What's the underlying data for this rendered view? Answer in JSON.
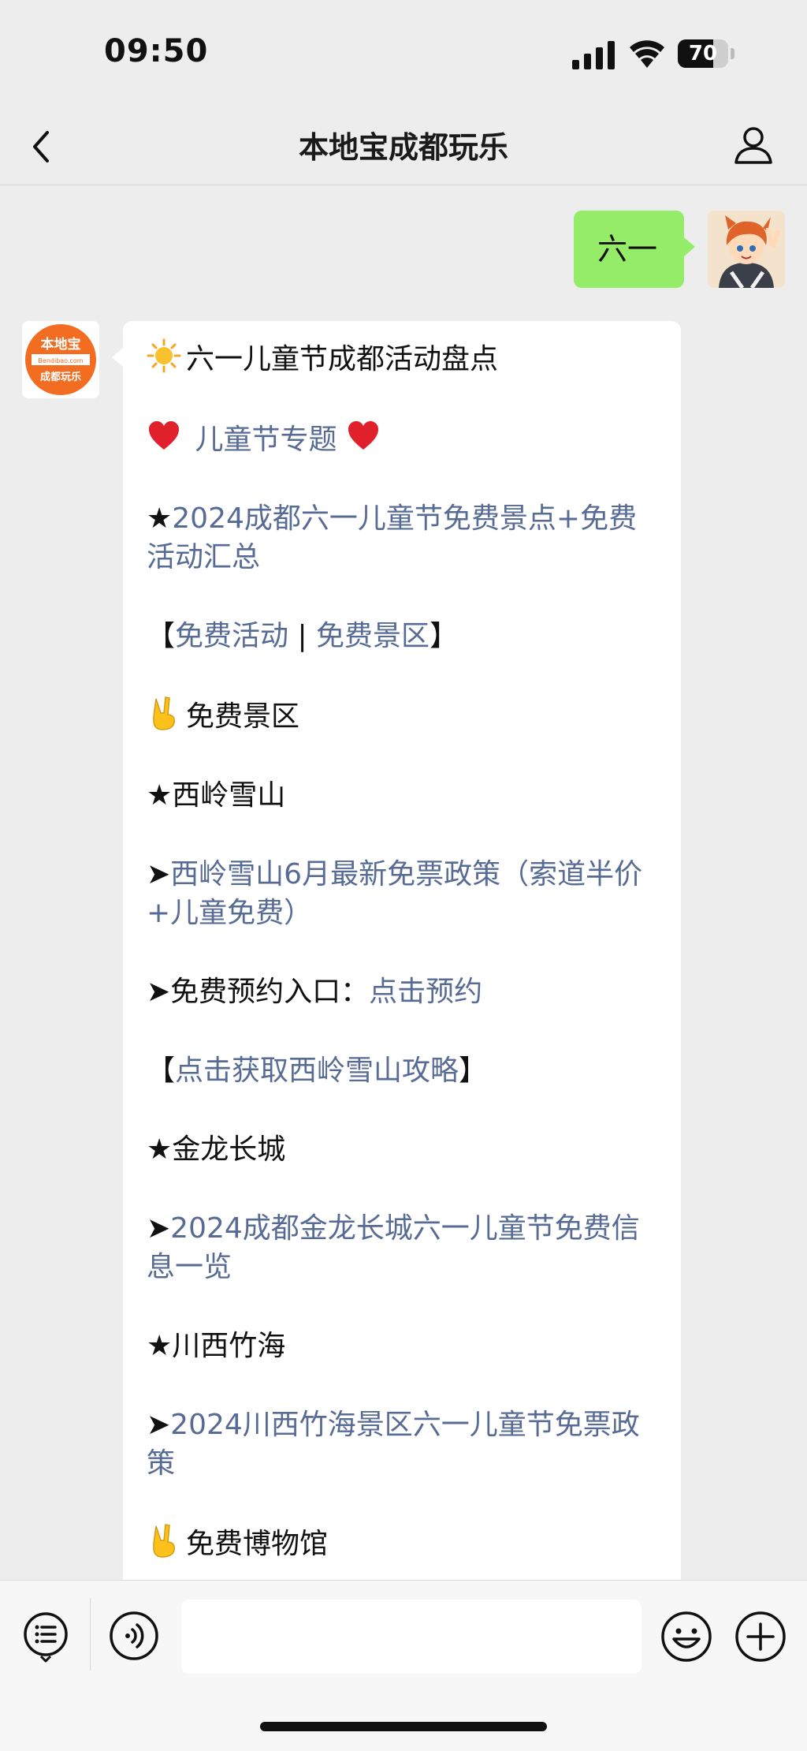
{
  "status_bar": {
    "time": "09:50",
    "battery_level": "70",
    "battery_fraction": 0.7
  },
  "nav": {
    "title": "本地宝成都玩乐"
  },
  "outgoing_message": {
    "text": "六一"
  },
  "bot_avatar": {
    "logo_text": "本地宝",
    "site_text": "Bendibao.com",
    "sub_text": "成都玩乐",
    "brand_color": "#f26d21"
  },
  "message": {
    "lines": [
      {
        "icon": "sun",
        "segments": [
          {
            "text": "六一儿童节成都活动盘点",
            "link": false
          }
        ]
      },
      {
        "icon": "heart",
        "trailing_icon": "heart",
        "segments": [
          {
            "text": " 儿童节专题 ",
            "link": true
          }
        ]
      },
      {
        "icon": null,
        "segments": [
          {
            "text": "★",
            "link": false
          },
          {
            "text": "2024成都六一儿童节免费景点+免费活动汇总",
            "link": true
          }
        ]
      },
      {
        "icon": null,
        "segments": [
          {
            "text": "【",
            "link": false
          },
          {
            "text": "免费活动",
            "link": true
          },
          {
            "text": " | ",
            "link": false
          },
          {
            "text": "免费景区",
            "link": true
          },
          {
            "text": "】",
            "link": false
          }
        ]
      },
      {
        "icon": "victory",
        "segments": [
          {
            "text": "免费景区",
            "link": false
          }
        ]
      },
      {
        "icon": null,
        "segments": [
          {
            "text": "★西岭雪山",
            "link": false
          }
        ]
      },
      {
        "icon": null,
        "segments": [
          {
            "text": "➤",
            "link": false
          },
          {
            "text": "西岭雪山6月最新免票政策（索道半价+儿童免费）",
            "link": true
          }
        ]
      },
      {
        "icon": null,
        "segments": [
          {
            "text": "➤免费预约入口：",
            "link": false
          },
          {
            "text": "点击预约",
            "link": true
          }
        ]
      },
      {
        "icon": null,
        "segments": [
          {
            "text": "【",
            "link": false
          },
          {
            "text": "点击获取西岭雪山攻略",
            "link": true
          },
          {
            "text": "】",
            "link": false
          }
        ]
      },
      {
        "icon": null,
        "segments": [
          {
            "text": "★金龙长城",
            "link": false
          }
        ]
      },
      {
        "icon": null,
        "segments": [
          {
            "text": "➤",
            "link": false
          },
          {
            "text": "2024成都金龙长城六一儿童节免费信息一览",
            "link": true
          }
        ]
      },
      {
        "icon": null,
        "segments": [
          {
            "text": "★川西竹海",
            "link": false
          }
        ]
      },
      {
        "icon": null,
        "segments": [
          {
            "text": "➤",
            "link": false
          },
          {
            "text": "2024川西竹海景区六一儿童节免票政策",
            "link": true
          }
        ]
      },
      {
        "icon": "victory",
        "segments": [
          {
            "text": "免费博物馆",
            "link": false
          }
        ]
      }
    ]
  },
  "input_bar": {
    "input_value": "",
    "input_placeholder": ""
  },
  "colors": {
    "link": "#576b95",
    "outgoing_bubble": "#95ec69",
    "background": "#ededed"
  }
}
